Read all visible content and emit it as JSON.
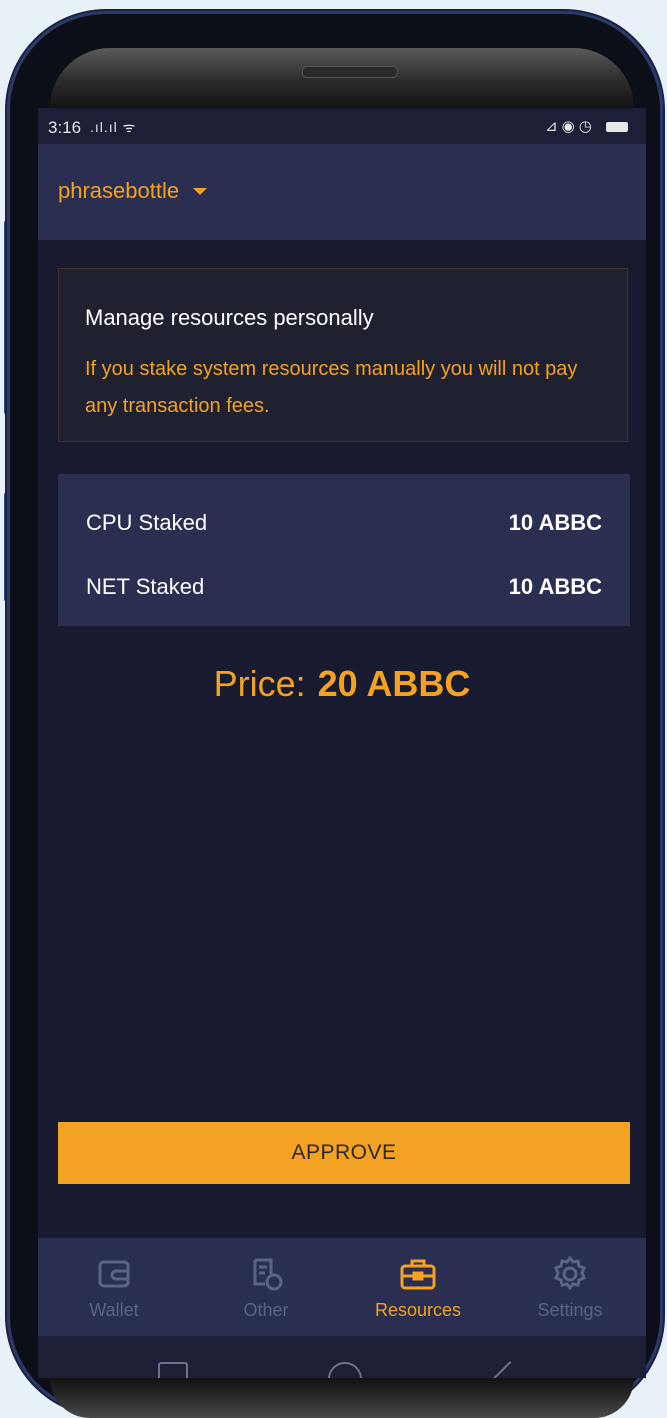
{
  "status_bar": {
    "time": "3:16",
    "signal": ".ıl.ıl ᯤ",
    "icons": "⊿◉◷"
  },
  "header": {
    "account_name": "phrasebottle"
  },
  "info_card": {
    "title": "Manage resources personally",
    "description": "If you stake system resources manually you will not pay any transaction fees."
  },
  "stakes": [
    {
      "label": "CPU Staked",
      "value": "10 ABBC"
    },
    {
      "label": "NET Staked",
      "value": "10 ABBC"
    }
  ],
  "price": {
    "label": "Price:",
    "amount": "20 ABBC"
  },
  "approve_label": "APPROVE",
  "tabs": [
    {
      "label": "Wallet",
      "icon": "wallet-icon",
      "active": false
    },
    {
      "label": "Other",
      "icon": "other-icon",
      "active": false
    },
    {
      "label": "Resources",
      "icon": "briefcase-icon",
      "active": true
    },
    {
      "label": "Settings",
      "icon": "gear-icon",
      "active": false
    }
  ],
  "colors": {
    "accent": "#f3a221",
    "background": "#181a30",
    "card": "#2a2f52",
    "inactive": "#5c6288"
  }
}
